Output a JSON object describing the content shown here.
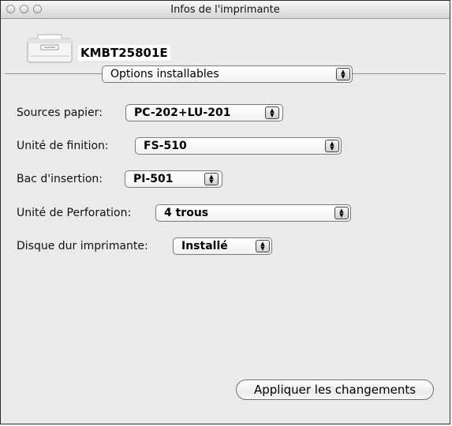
{
  "window": {
    "title": "Infos de l'imprimante"
  },
  "printer": {
    "name": "KMBT25801E",
    "icon": "printer-icon"
  },
  "section_popup": {
    "value": "Options installables"
  },
  "options": [
    {
      "label": "Sources papier:",
      "value": "PC-202+LU-201"
    },
    {
      "label": "Unité de finition:",
      "value": "FS-510"
    },
    {
      "label": "Bac d'insertion:",
      "value": "PI-501"
    },
    {
      "label": "Unité de Perforation:",
      "value": "4 trous"
    },
    {
      "label": "Disque dur imprimante:",
      "value": "Installé"
    }
  ],
  "apply_button": {
    "label": "Appliquer les changements"
  }
}
